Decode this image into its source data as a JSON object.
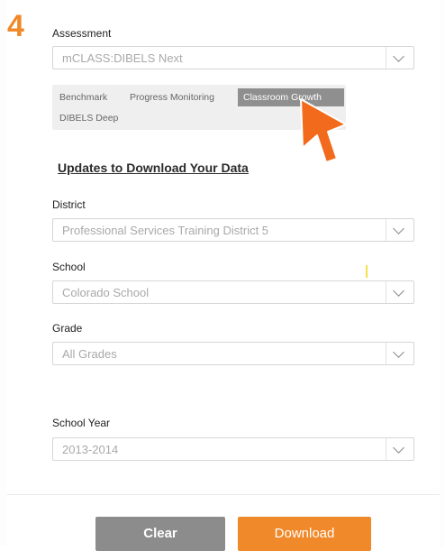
{
  "step": {
    "number": "4"
  },
  "assessment": {
    "label": "Assessment",
    "selected": "mCLASS:DIBELS Next",
    "tabs": [
      {
        "label": "Benchmark",
        "active": false
      },
      {
        "label": "Progress Monitoring",
        "active": false
      },
      {
        "label": "Classroom Growth",
        "active": true
      },
      {
        "label": "DIBELS Deep",
        "active": false
      }
    ]
  },
  "section": {
    "heading": "Updates to Download Your Data"
  },
  "district": {
    "label": "District",
    "selected": "Professional Services Training District 5"
  },
  "school": {
    "label": "School",
    "selected": "Colorado School"
  },
  "grade": {
    "label": "Grade",
    "selected": "All Grades"
  },
  "school_year": {
    "label": "School Year",
    "selected": "2013-2014"
  },
  "actions": {
    "clear_label": "Clear",
    "download_label": "Download"
  },
  "colors": {
    "accent": "#f0892a",
    "active_tab": "#8f8f8f",
    "clear_button": "#8c8c8c",
    "cursor": "#f26a1b"
  },
  "icons": {
    "select_chevron": "chevron-down-icon",
    "pointer": "cursor-arrow-icon"
  }
}
